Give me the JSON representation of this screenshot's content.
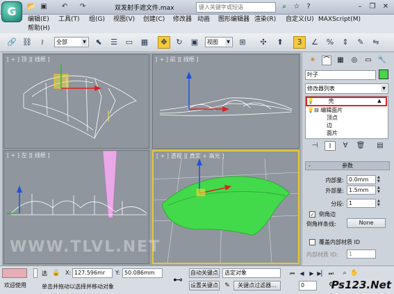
{
  "title": {
    "filename": "双发射手遮文件.max",
    "search_placeholder": "键入关键字或短语",
    "toolbar_icons": [
      "open-icon",
      "save-icon",
      "undo-icon",
      "redo-icon"
    ]
  },
  "menu": {
    "items": [
      "编辑(E)",
      "工具(T)",
      "组(G)",
      "视图(V)",
      "创建(C)",
      "修改器",
      "动画",
      "图形编辑器",
      "渲染(R)",
      "自定义(U)",
      "MAXScript(M)",
      "帮助(H)"
    ]
  },
  "toolbar": {
    "selection_filter": "全部",
    "ref_coord": "视图",
    "snap_number": "3"
  },
  "viewports": {
    "top_left": "[ + ] 顶 ][ 线框 ]",
    "top_right": "[ + ] 前 ][ 线框 ]",
    "bottom_left": "[ + ] 左 ][ 线框 ]",
    "bottom_right": "[ + ] 透视 ][ 真实 + 高光 ]",
    "mesh_color": "#42d94a",
    "wire_color": "#ffffff"
  },
  "command_panel": {
    "object_name": "叶子",
    "swatch_color": "#45d64b",
    "modifier_list": "修改器列表",
    "stack": {
      "selected": "壳",
      "base": "编辑面片",
      "subitems": [
        "顶点",
        "边",
        "面片"
      ]
    },
    "rollout_title": "参数",
    "params": {
      "inner_label": "内部量:",
      "inner_value": "0.0mm",
      "outer_label": "外部量:",
      "outer_value": "1.5mm",
      "segments_label": "分段:",
      "segments_value": "1",
      "bevel_edges": "倒角边",
      "bevel_spline_label": "倒角样条线:",
      "bevel_spline_value": "None",
      "override_label": "覆盖内部材质 ID",
      "inner_mat_label": "内部材质 ID:",
      "inner_mat_value": "1"
    }
  },
  "bottom": {
    "welcome": "欢迎使用",
    "status": "单击并拖动以选择并移动对象",
    "select_label": "选",
    "x_label": "X:",
    "x_value": "127.596mr",
    "y_label": "Y:",
    "y_value": "50.086mm",
    "auto_key": "自动关键点",
    "set_key": "设置关键点",
    "selected_obj": "选定对象",
    "key_filter": "关键点过滤器...",
    "frame": "0",
    "timeline_ticks": [
      "0",
      "10",
      "20",
      "30",
      "40",
      "50",
      "60",
      "70",
      "80",
      "90",
      "100"
    ]
  },
  "watermark": {
    "site": "WWW.TLVL.NET",
    "brand": "Ps123.Net"
  }
}
